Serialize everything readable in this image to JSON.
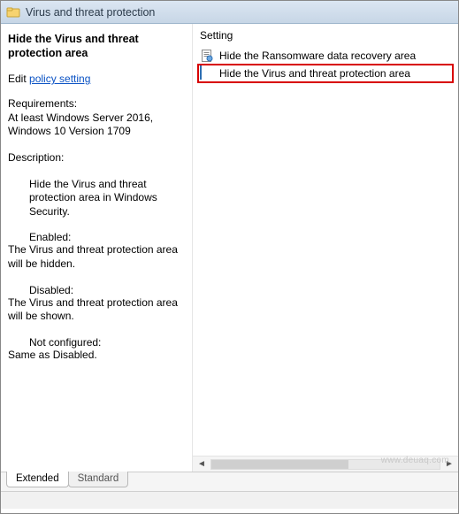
{
  "window": {
    "title": "Virus and threat protection"
  },
  "leftPane": {
    "heading": "Hide the Virus and threat protection area",
    "editPrefix": "Edit ",
    "editLink": "policy setting",
    "reqLabel": "Requirements:",
    "req1": "At least Windows Server 2016,",
    "req2": "Windows 10 Version 1709",
    "descLabel": "Description:",
    "descBody": "Hide the Virus and threat protection area in Windows Security.",
    "enabledLabel": "Enabled:",
    "enabledBody": "The Virus and threat protection area will be hidden.",
    "disabledLabel": "Disabled:",
    "disabledBody": "The Virus and threat protection area will be shown.",
    "notcfgLabel": "Not configured:",
    "notcfgBody": "Same as Disabled."
  },
  "list": {
    "columnHeader": "Setting",
    "items": [
      {
        "label": "Hide the Ransomware data recovery area",
        "selected": false
      },
      {
        "label": "Hide the Virus and threat protection area",
        "selected": true
      }
    ]
  },
  "tabs": {
    "extended": "Extended",
    "standard": "Standard"
  },
  "watermark": "www.deuaq.com"
}
